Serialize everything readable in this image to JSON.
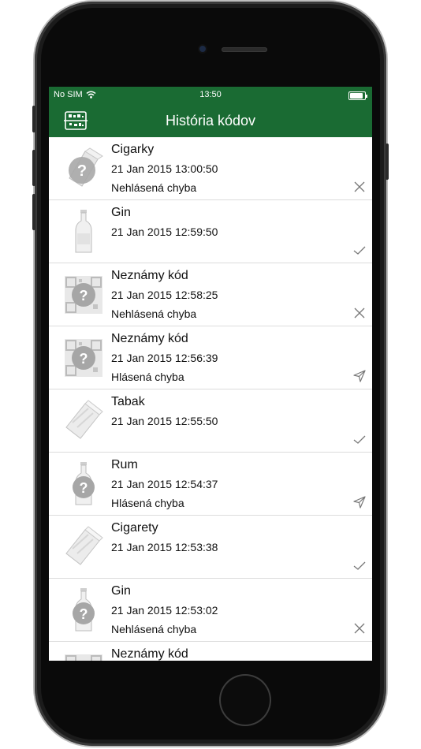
{
  "status_bar": {
    "carrier": "No SIM",
    "time": "13:50"
  },
  "nav": {
    "title": "História kódov"
  },
  "history": [
    {
      "title": "Cigarky",
      "date": "21 Jan 2015 13:00:50",
      "status": "Nehlásená chyba",
      "thumb": "cigar-pack-question-icon",
      "action": "close-icon"
    },
    {
      "title": "Gin",
      "date": "21 Jan 2015 12:59:50",
      "status": "",
      "thumb": "bottle-icon",
      "action": "checkmark-icon"
    },
    {
      "title": "Neznámy kód",
      "date": "21 Jan 2015 12:58:25",
      "status": "Nehlásená chyba",
      "thumb": "qr-question-icon",
      "action": "close-icon"
    },
    {
      "title": "Neznámy kód",
      "date": "21 Jan 2015 12:56:39",
      "status": "Hlásená chyba",
      "thumb": "qr-question-icon",
      "action": "send-icon"
    },
    {
      "title": "Tabak",
      "date": "21 Jan 2015 12:55:50",
      "status": "",
      "thumb": "tobacco-pack-icon",
      "action": "checkmark-icon"
    },
    {
      "title": "Rum",
      "date": "21 Jan 2015 12:54:37",
      "status": "Hlásená chyba",
      "thumb": "bottle-question-icon",
      "action": "send-icon"
    },
    {
      "title": "Cigarety",
      "date": "21 Jan 2015 12:53:38",
      "status": "",
      "thumb": "cigarette-pack-icon",
      "action": "checkmark-icon"
    },
    {
      "title": "Gin",
      "date": "21 Jan 2015 12:53:02",
      "status": "Nehlásená chyba",
      "thumb": "bottle-question-icon",
      "action": "close-icon"
    },
    {
      "title": "Neznámy kód",
      "date": "",
      "status": "",
      "thumb": "qr-question-icon",
      "action": ""
    }
  ]
}
